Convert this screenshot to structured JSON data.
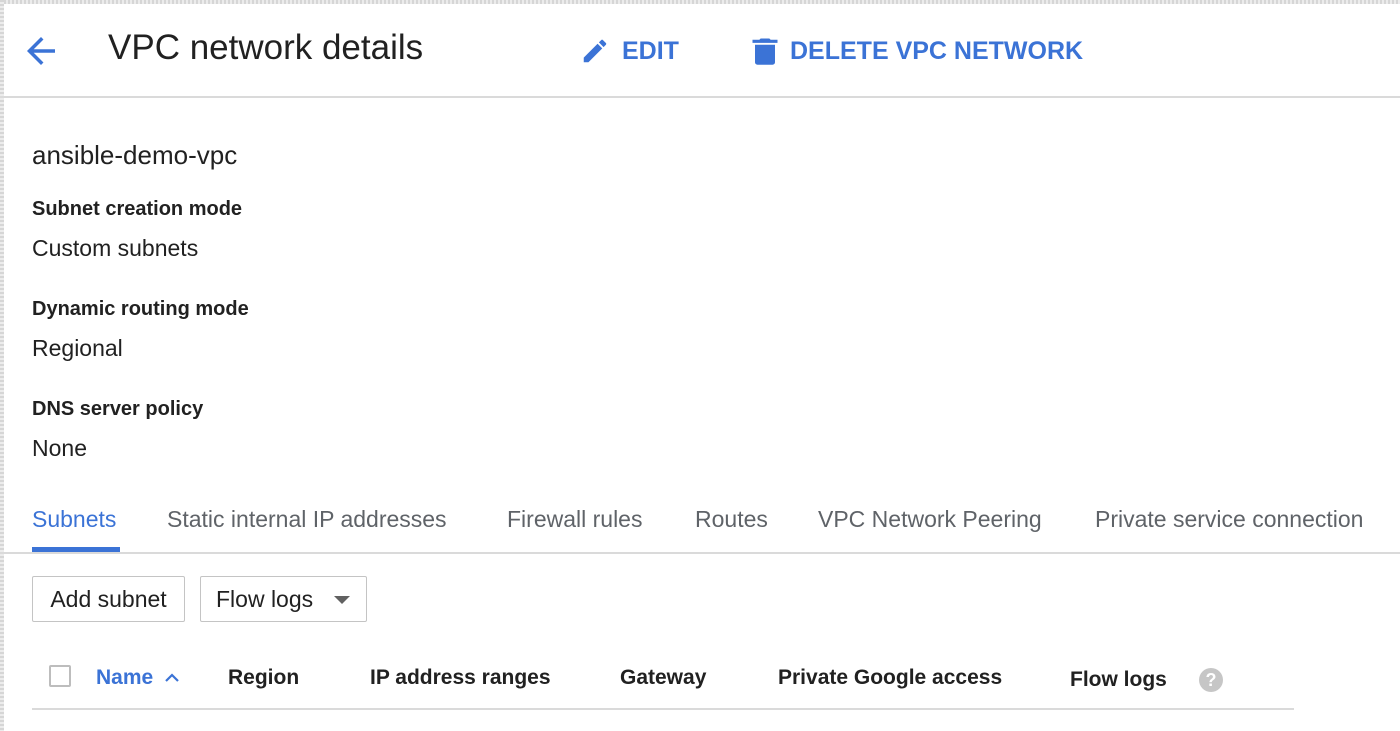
{
  "header": {
    "back_icon": "arrow-back-icon",
    "title": "VPC network details",
    "edit_label": "EDIT",
    "edit_icon": "pencil-icon",
    "delete_label": "DELETE VPC NETWORK",
    "delete_icon": "trash-icon",
    "accent_color": "#3b73d6"
  },
  "network": {
    "name": "ansible-demo-vpc",
    "fields": [
      {
        "label": "Subnet creation mode",
        "value": "Custom subnets"
      },
      {
        "label": "Dynamic routing mode",
        "value": "Regional"
      },
      {
        "label": "DNS server policy",
        "value": "None"
      }
    ]
  },
  "tabs": [
    {
      "label": "Subnets",
      "active": true
    },
    {
      "label": "Static internal IP addresses",
      "active": false
    },
    {
      "label": "Firewall rules",
      "active": false
    },
    {
      "label": "Routes",
      "active": false
    },
    {
      "label": "VPC Network Peering",
      "active": false
    },
    {
      "label": "Private service connection",
      "active": false
    }
  ],
  "toolbar": {
    "add_subnet_label": "Add subnet",
    "flow_logs_label": "Flow logs"
  },
  "table": {
    "columns": [
      {
        "label": "Name",
        "sorted": "ascending"
      },
      {
        "label": "Region"
      },
      {
        "label": "IP address ranges"
      },
      {
        "label": "Gateway"
      },
      {
        "label": "Private Google access"
      },
      {
        "label": "Flow logs"
      }
    ],
    "sort_icon": "chevron-up-icon",
    "help_icon": "help-icon",
    "help_glyph": "?"
  }
}
